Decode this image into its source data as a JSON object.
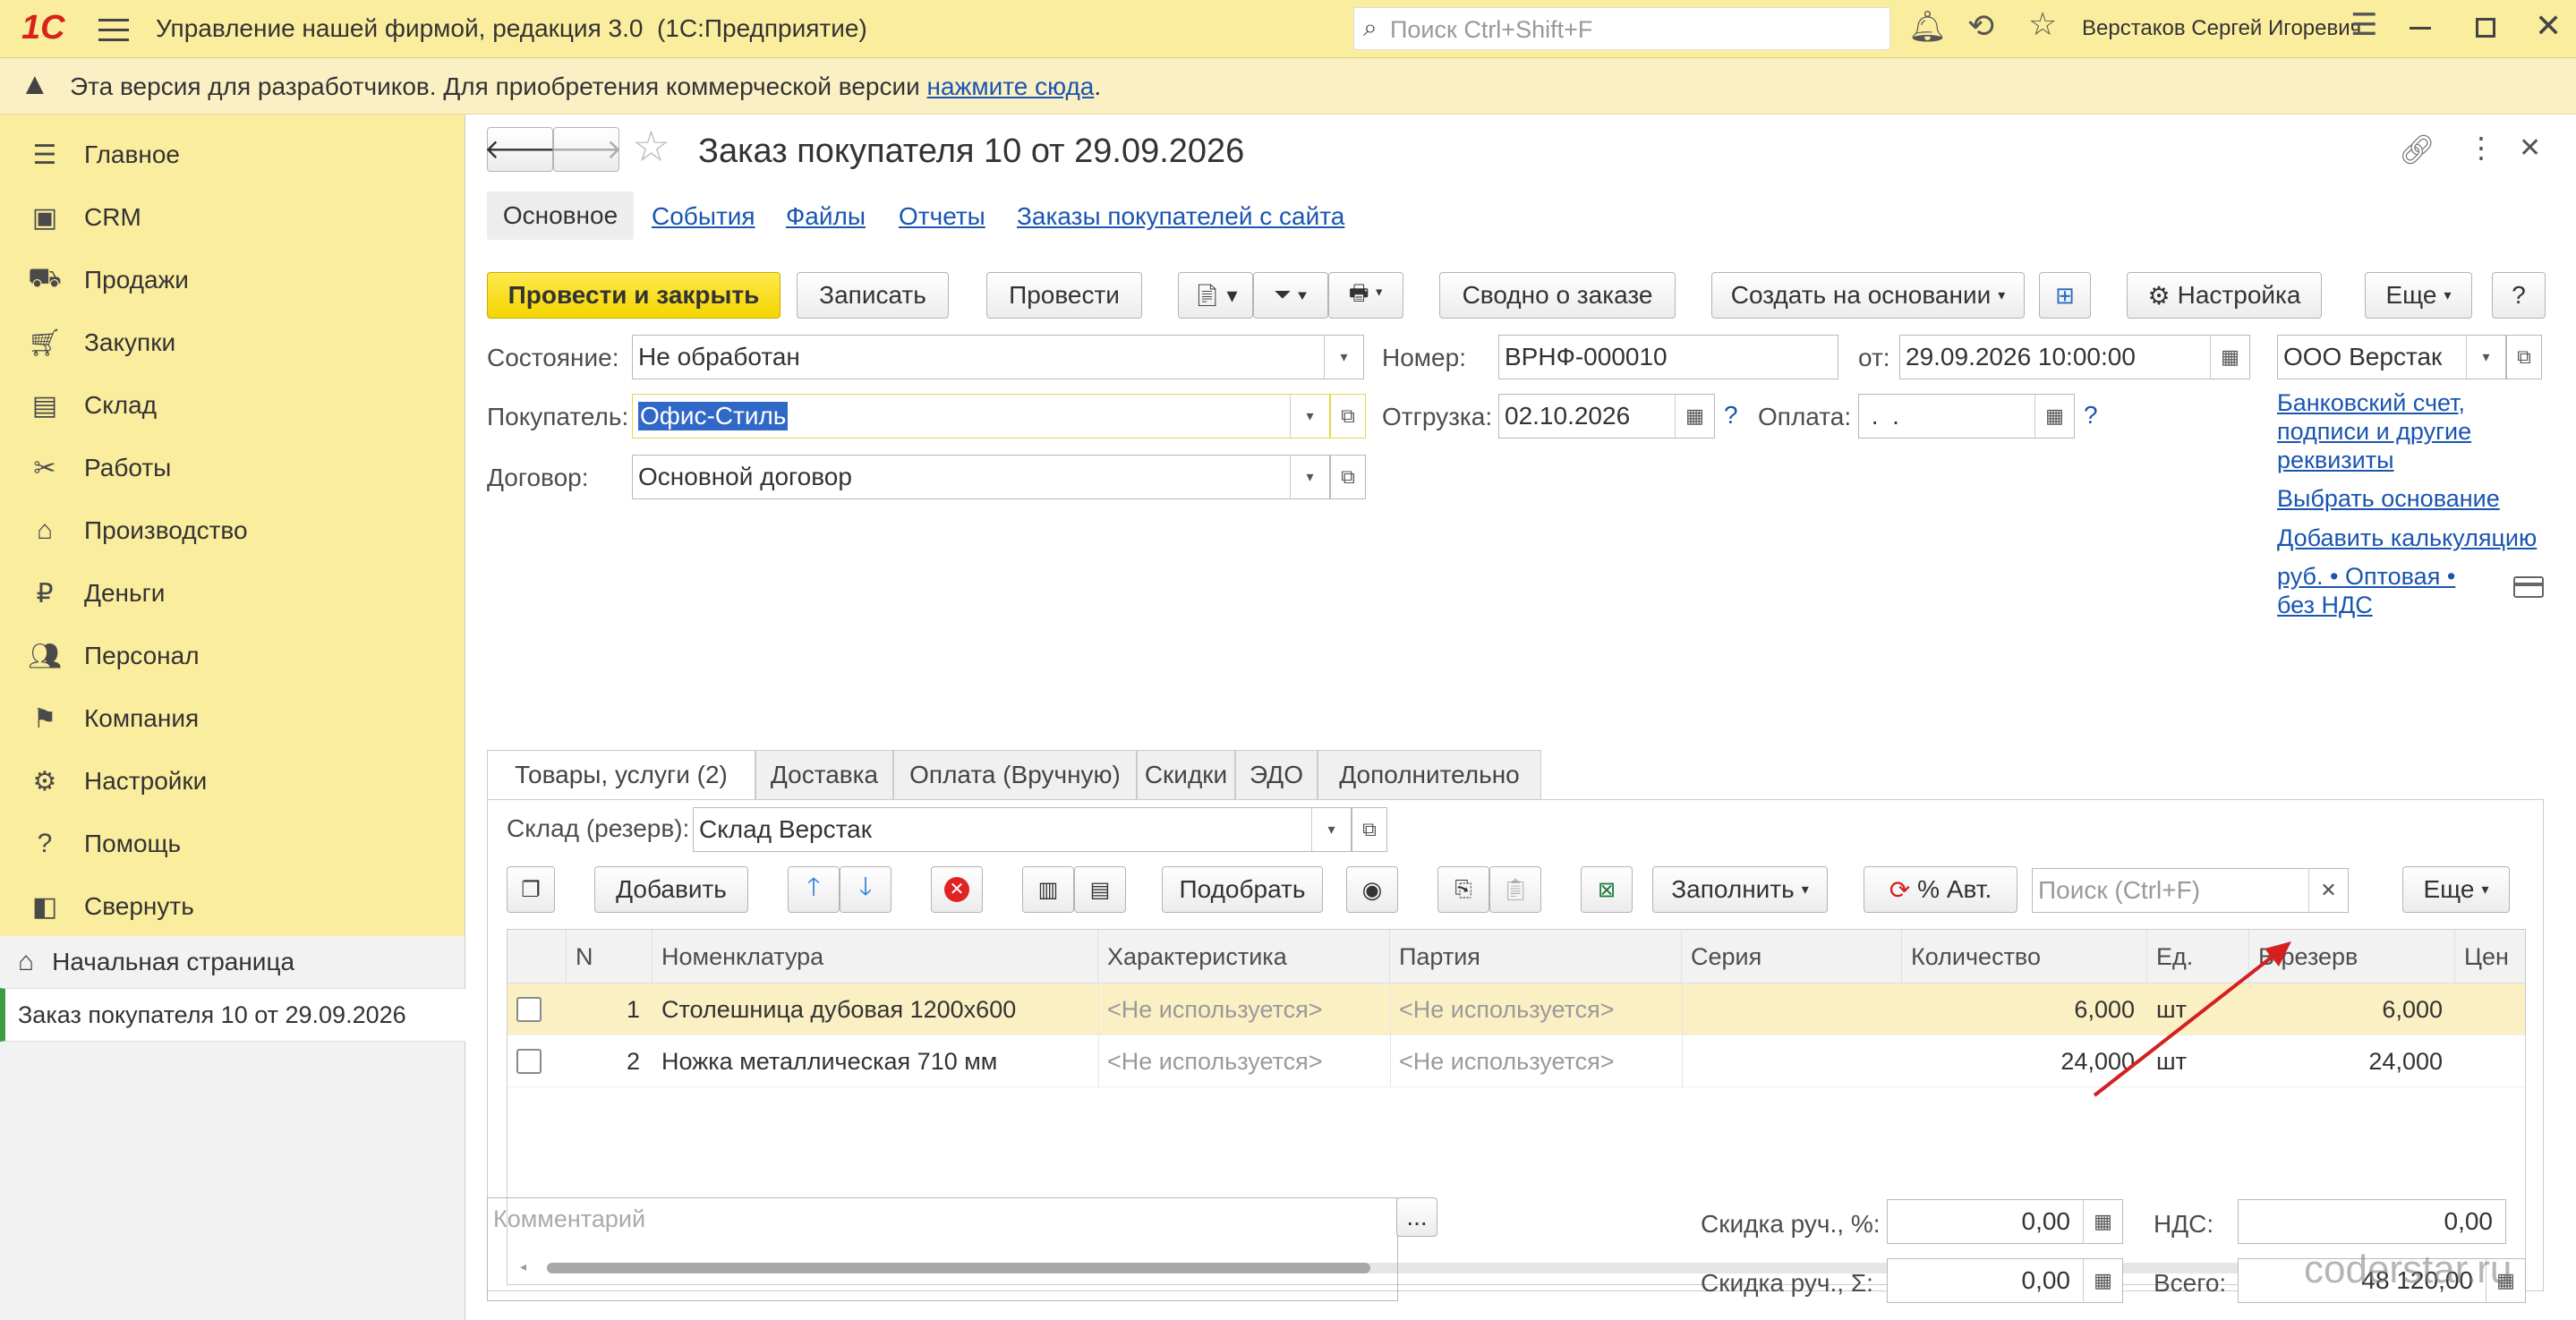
{
  "app": {
    "logo": "1С",
    "title": "Управление нашей фирмой, редакция 3.0  (1С:Предприятие)",
    "search_placeholder": "Поиск Ctrl+Shift+F",
    "user": "Верстаков Сергей Игоревич"
  },
  "warning": {
    "text": "Эта версия для разработчиков. Для приобретения коммерческой версии",
    "link": "нажмите сюда",
    "after": "."
  },
  "sidebar": {
    "items": [
      {
        "label": "Главное",
        "icon": "menu-lines-icon"
      },
      {
        "label": "CRM",
        "icon": "contact-card-icon"
      },
      {
        "label": "Продажи",
        "icon": "basket-icon"
      },
      {
        "label": "Закупки",
        "icon": "cart-icon"
      },
      {
        "label": "Склад",
        "icon": "warehouse-icon"
      },
      {
        "label": "Работы",
        "icon": "tools-icon"
      },
      {
        "label": "Производство",
        "icon": "factory-icon"
      },
      {
        "label": "Деньги",
        "icon": "ruble-icon"
      },
      {
        "label": "Персонал",
        "icon": "people-icon"
      },
      {
        "label": "Компания",
        "icon": "flag-icon"
      },
      {
        "label": "Настройки",
        "icon": "gear-icon"
      },
      {
        "label": "Помощь",
        "icon": "help-icon"
      },
      {
        "label": "Свернуть",
        "icon": "collapse-icon"
      }
    ],
    "home": "Начальная страница",
    "open_doc": "Заказ покупателя 10 от 29.09.2026"
  },
  "doc": {
    "title": "Заказ покупателя 10 от 29.09.2026",
    "nav_tabs": [
      "Основное",
      "События",
      "Файлы",
      "Отчеты",
      "Заказы покупателей с сайта"
    ],
    "toolbar": {
      "post_close": "Провести и закрыть",
      "save": "Записать",
      "post": "Провести",
      "summary": "Сводно о заказе",
      "create_based": "Создать на основании",
      "settings": "Настройка",
      "more": "Еще",
      "help": "?"
    },
    "fields": {
      "state_label": "Состояние:",
      "state": "Не обработан",
      "customer_label": "Покупатель:",
      "customer": "Офис-Стиль",
      "contract_label": "Договор:",
      "contract": "Основной договор",
      "number_label": "Номер:",
      "number": "ВРНФ-000010",
      "date_label": "от:",
      "date": "29.09.2026 10:00:00",
      "shipment_label": "Отгрузка:",
      "shipment": "02.10.2026",
      "payment_label": "Оплата:",
      "payment": " .  .",
      "org": "ООО Верстак",
      "q": "?"
    },
    "side_links": {
      "bank": "Банковский счет, подписи и другие реквизиты",
      "choose_base": "Выбрать основание",
      "add_calc": "Добавить калькуляцию",
      "price_type": "руб. • Оптовая • без НДС"
    },
    "tabs": [
      "Товары, услуги (2)",
      "Доставка",
      "Оплата (Вручную)",
      "Скидки",
      "ЭДО",
      "Дополнительно"
    ],
    "warehouse_label": "Склад (резерв):",
    "warehouse": "Склад Верстак",
    "table_toolbar": {
      "add": "Добавить",
      "pick": "Подобрать",
      "fill": "Заполнить",
      "auto_pct": "% Авт.",
      "search_placeholder": "Поиск (Ctrl+F)",
      "more": "Еще"
    },
    "table": {
      "headers": [
        "N",
        "Номенклатура",
        "Характеристика",
        "Партия",
        "Серия",
        "Количество",
        "Ед.",
        "В резерв",
        "Цен"
      ],
      "rows": [
        {
          "n": "1",
          "item": "Столешница дубовая 1200х600",
          "char": "<Не используется>",
          "batch": "<Не используется>",
          "series": "",
          "qty": "6,000",
          "unit": "шт",
          "reserve": "6,000"
        },
        {
          "n": "2",
          "item": "Ножка металлическая 710 мм",
          "char": "<Не используется>",
          "batch": "<Не используется>",
          "series": "",
          "qty": "24,000",
          "unit": "шт",
          "reserve": "24,000"
        }
      ]
    },
    "footer": {
      "comment_placeholder": "Комментарий",
      "ellipsis": "...",
      "disc_pct_label": "Скидка руч., %:",
      "disc_pct": "0,00",
      "disc_sum_label": "Скидка руч., Σ:",
      "disc_sum": "0,00",
      "vat_label": "НДС:",
      "vat": "0,00",
      "total_label": "Всего:",
      "total": "48 120,00"
    },
    "watermark": "coderstar.ru"
  },
  "colors": {
    "accent_yellow": "#fbed9e",
    "primary_button": "#f5d500",
    "link": "#1a55b0",
    "arrow": "#d42020"
  }
}
